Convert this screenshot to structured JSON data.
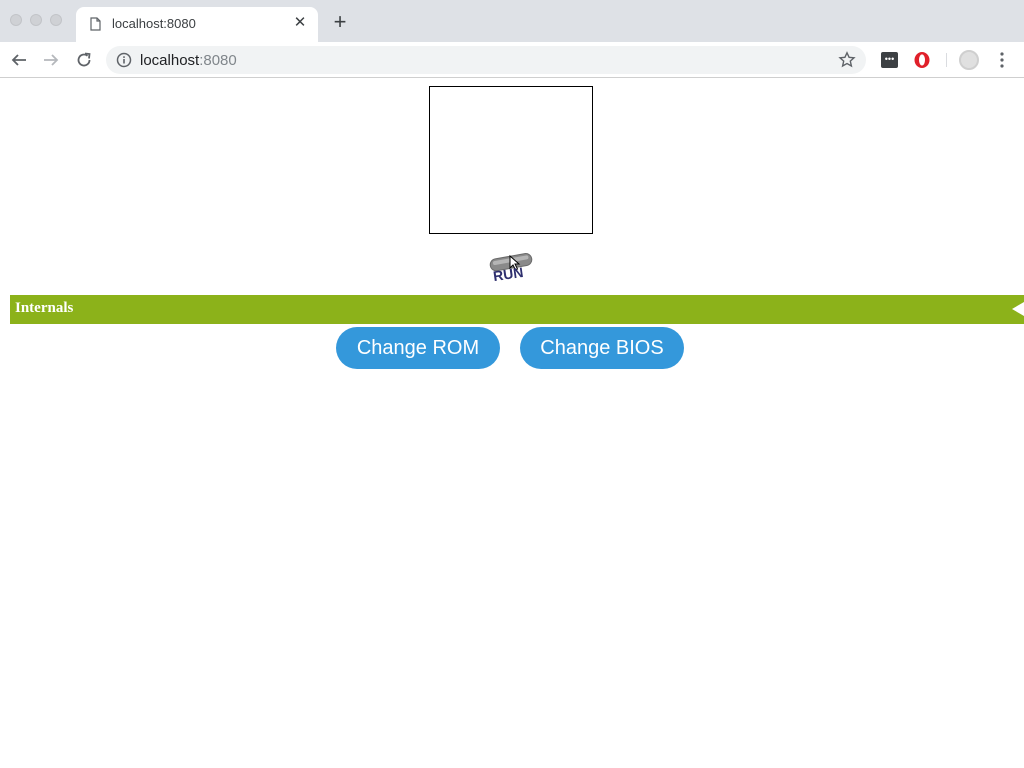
{
  "browser": {
    "tab_title": "localhost:8080",
    "tab_close_glyph": "✕",
    "new_tab_glyph": "+",
    "url_host": "localhost",
    "url_port": ":8080"
  },
  "icons": {
    "back": "back-arrow-icon",
    "forward": "forward-arrow-icon",
    "reload": "reload-icon",
    "info": "info-icon",
    "bookmark": "star-icon",
    "extension_1": "extension-icon",
    "extension_2": "opera-icon",
    "profile": "profile-avatar-icon",
    "menu": "kebab-menu-icon"
  },
  "page": {
    "run_label": "RUN",
    "internals_label": "Internals",
    "change_rom_label": "Change ROM",
    "change_bios_label": "Change BIOS"
  },
  "colors": {
    "internals_bar": "#8cb21a",
    "button_blue": "#3498db",
    "run_text": "#2e2f6e"
  }
}
